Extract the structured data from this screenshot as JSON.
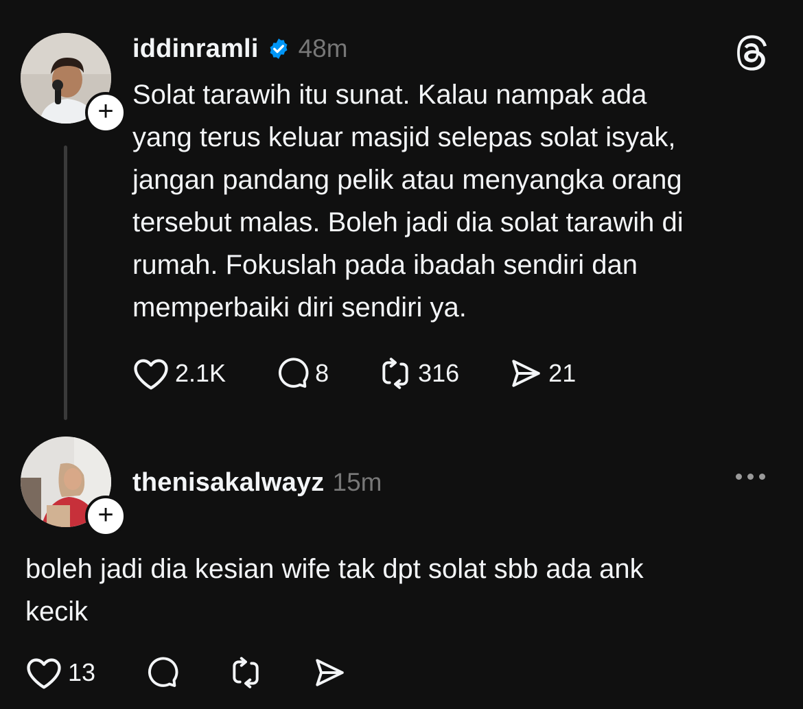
{
  "post": {
    "username": "iddinramli",
    "verified": true,
    "time": "48m",
    "text": "Solat tarawih itu sunat. Kalau nampak ada\nyang terus keluar masjid selepas solat isyak,\njangan pandang pelik atau menyangka orang\ntersebut malas. Boleh jadi dia solat tarawih di\nrumah. Fokuslah pada ibadah sendiri dan\nmemperbaiki diri sendiri ya.",
    "likes": "2.1K",
    "replies": "8",
    "reposts": "316",
    "shares": "21"
  },
  "reply": {
    "username": "thenisakalwayz",
    "time": "15m",
    "text": "boleh jadi dia kesian wife tak dpt solat sbb ada ank\nkecik",
    "likes": "13"
  },
  "colors": {
    "background": "#101010",
    "text": "#f3f5f7",
    "muted": "#777777",
    "verified_blue": "#0095f6",
    "thread_line": "#3a3a3a"
  },
  "icons": [
    "threads-logo-icon",
    "verified-badge-icon",
    "heart-icon",
    "comment-icon",
    "repost-icon",
    "share-icon",
    "more-icon",
    "plus-icon"
  ]
}
